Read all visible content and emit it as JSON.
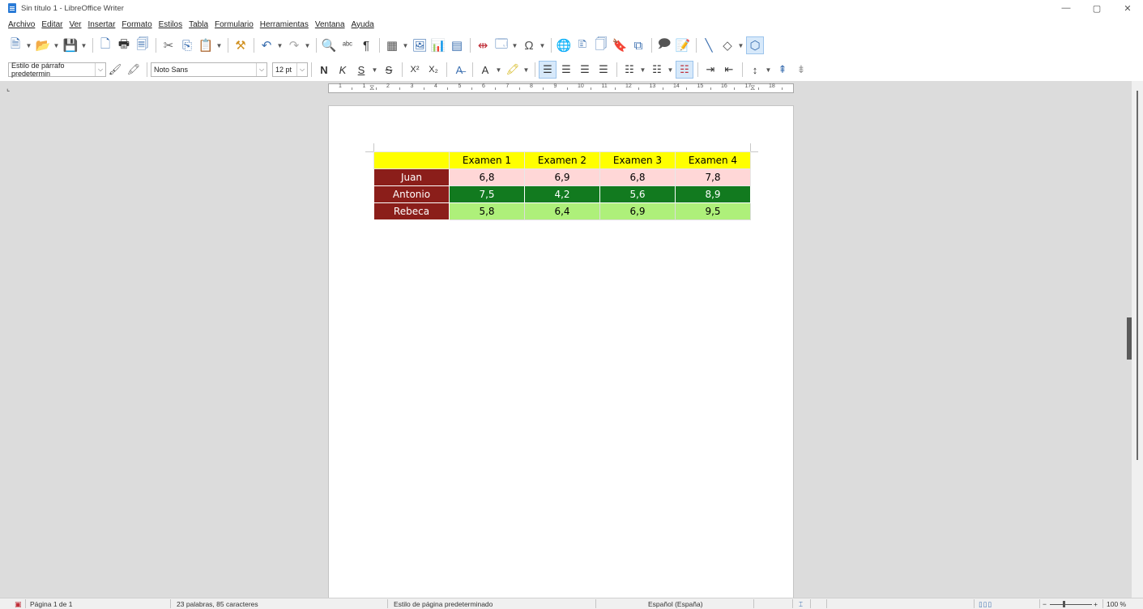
{
  "window": {
    "title": "Sin título 1 - LibreOffice Writer",
    "controls": {
      "minimize": "—",
      "maximize": "▢",
      "close": "✕"
    }
  },
  "menu": [
    "Archivo",
    "Editar",
    "Ver",
    "Insertar",
    "Formato",
    "Estilos",
    "Tabla",
    "Formulario",
    "Herramientas",
    "Ventana",
    "Ayuda"
  ],
  "toolbar_format": {
    "paragraph_style": "Estilo de párrafo predetermin",
    "font_name": "Noto Sans",
    "font_size": "12 pt",
    "bold": "N",
    "italic": "K",
    "underline": "S",
    "strikethrough": "S",
    "superscript": "X²",
    "subscript": "X₂"
  },
  "ruler": {
    "numbers": [
      "1",
      "1",
      "2",
      "3",
      "4",
      "5",
      "6",
      "7",
      "8",
      "9",
      "10",
      "11",
      "12",
      "13",
      "14",
      "15",
      "16",
      "17",
      "18"
    ]
  },
  "table": {
    "headers": [
      "",
      "Examen 1",
      "Examen 2",
      "Examen 3",
      "Examen 4"
    ],
    "rows": [
      {
        "name": "Juan",
        "scores": [
          "6,8",
          "6,9",
          "6,8",
          "7,8"
        ]
      },
      {
        "name": "Antonio",
        "scores": [
          "7,5",
          "4,2",
          "5,6",
          "8,9"
        ]
      },
      {
        "name": "Rebeca",
        "scores": [
          "5,8",
          "6,4",
          "6,9",
          "9,5"
        ]
      }
    ]
  },
  "colors": {
    "header_bg": "#ffff00",
    "name_col_bg": "#8b1e1a",
    "row_juan_bg": "#ffd7d7",
    "row_antonio_bg": "#127a1f",
    "row_rebeca_bg": "#aef07a",
    "workspace_bg": "#dcdcdc"
  },
  "statusbar": {
    "page": "Página 1 de 1",
    "words": "23 palabras, 85 caracteres",
    "page_style": "Estilo de página predeterminado",
    "language": "Español (España)",
    "zoom": "100 %"
  }
}
